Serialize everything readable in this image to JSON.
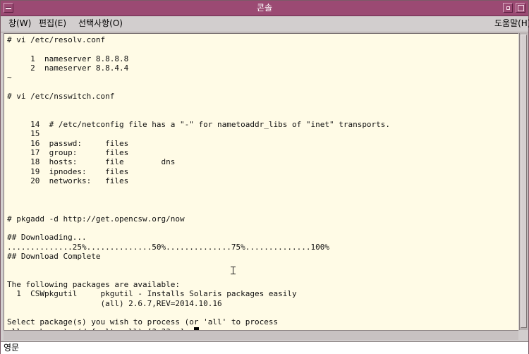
{
  "window": {
    "title": "콘솔"
  },
  "menubar": {
    "window_label": "창(W)",
    "edit_label": "편집(E)",
    "options_label": "선택사항(O)",
    "help_label": "도움말(H)"
  },
  "terminal": {
    "lines": [
      "# vi /etc/resolv.conf",
      "",
      "     1  nameserver 8.8.8.8",
      "     2  nameserver 8.8.4.4",
      "~",
      "",
      "# vi /etc/nsswitch.conf",
      "",
      "",
      "     14  # /etc/netconfig file has a \"-\" for nametoaddr_libs of \"inet\" transports.",
      "     15",
      "     16  passwd:     files",
      "     17  group:      files",
      "     18  hosts:      file        dns",
      "     19  ipnodes:    files",
      "     20  networks:   files",
      "",
      "",
      "",
      "# pkgadd -d http://get.opencsw.org/now",
      "",
      "## Downloading...",
      "..............25%..............50%..............75%..............100%",
      "## Download Complete",
      "",
      "",
      "The following packages are available:",
      "  1  CSWpkgutil     pkgutil - Installs Solaris packages easily",
      "                    (all) 2.6.7,REV=2014.10.16",
      "",
      "Select package(s) you wish to process (or 'all' to process",
      "all packages). (default: all) [?,??,q]: "
    ]
  },
  "status": {
    "input_mode": "영문"
  }
}
